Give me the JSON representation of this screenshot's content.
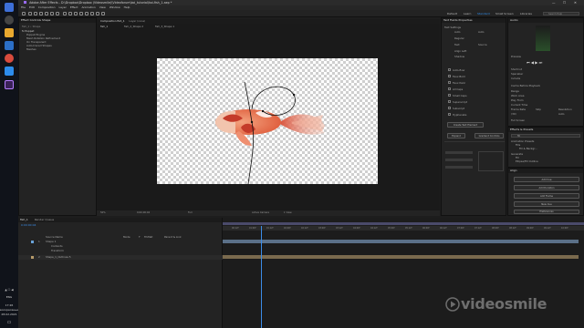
{
  "os": {
    "clock_time": "17:26",
    "clock_day": "воскресенье",
    "clock_date": "28.02.2021",
    "lang": "ENG"
  },
  "window": {
    "title": "Adobe After Effects - D:\\Dropbox\\Dropbox (Videosmile)\\Videoforum\\koi_tutorial\\koi-fish_1.aep *"
  },
  "menu": [
    "File",
    "Edit",
    "Composition",
    "Layer",
    "Effect",
    "Animation",
    "View",
    "Window",
    "Help"
  ],
  "workspaces": [
    "Default",
    "Learn",
    "Standard",
    "Small Screen",
    "Libraries"
  ],
  "search_placeholder": "Search Help",
  "project": {
    "tab": "Effect Controls  Shape",
    "breadcrumb": "fish_1 • Shape",
    "lines": [
      "fx  Puppet",
      "Puppet Engine",
      "Mesh Rotation Refinement",
      "On Transparent",
      "Auto-traced Shapes",
      "Meshes"
    ]
  },
  "composition": {
    "tabs": [
      "Composition  fish_1",
      "Layer  (none)"
    ],
    "subtabs": [
      "fish_1",
      "fish_2_Shape 2",
      "fish_3_Shape 1"
    ],
    "zoom": "50%",
    "timecode": "0;00;00;04",
    "resolution": "Full",
    "camera": "Active Camera",
    "view": "1 View"
  },
  "timeline": {
    "tab": "fish_1",
    "render_queue": "Render Queue",
    "timecode": "0:00:00:04",
    "columns": [
      "Source Name",
      "Mode",
      "T",
      "TrkMat",
      "Parent & Link"
    ],
    "layers": [
      {
        "index": "1",
        "name": "Shape 1",
        "color": "#6aa3d9"
      },
      {
        "index": "",
        "name": "Contents",
        "color": "#6aa3d9"
      },
      {
        "index": "",
        "name": "Transform",
        "color": "#6aa3d9"
      },
      {
        "index": "2",
        "name": "Shape_1_Outlines 5",
        "color": "#b79b6a"
      }
    ],
    "ruler_ticks": [
      "00:12f",
      "01:00f",
      "01:12f",
      "02:00f",
      "02:12f",
      "03:00f",
      "03:12f",
      "04:00f",
      "04:12f",
      "05:00f",
      "05:12f",
      "06:00f",
      "06:12f",
      "07:00f",
      "07:12f",
      "08:00f",
      "08:12f",
      "09:00f",
      "09:12f",
      "10:00f"
    ]
  },
  "text_panel": {
    "tab": "Text Fields  Properties",
    "labels": [
      "Text Settings",
      "Auto",
      "Auto",
      "Regular",
      "Text",
      "Source",
      "Align Left",
      "Shadow",
      "Auto-flow",
      "Faux Bold",
      "Faux Italic",
      "All Caps",
      "Small Caps",
      "Superscript",
      "Subscript",
      "Hyphenate"
    ],
    "buttons": [
      "Create Text Element",
      "Expand",
      "Gradient Controls"
    ]
  },
  "info_panel": {
    "tab": "Audio",
    "labels": [
      "Preview",
      "Shortcut",
      "Spacebar",
      "Include",
      "Cache Before Playback",
      "Range",
      "Work Area",
      "Play From",
      "Current Time",
      "Frame Rate",
      "Skip",
      "Resolution",
      "Auto",
      "(30)",
      "Full Screen"
    ]
  },
  "effects": {
    "tab": "Effects & Presets",
    "search": "fill",
    "groups": [
      "Animation Presets",
      "Fills",
      "Fill & Backgr...",
      "Generate",
      "Fill",
      "Ellipse/Fill Outline"
    ]
  },
  "align": {
    "tab": "Align",
    "buttons": [
      "Add Cue",
      "Add Duration",
      "Add Frame",
      "New Cue",
      "Preferences"
    ]
  },
  "brand": {
    "watermark": "videosmile"
  }
}
